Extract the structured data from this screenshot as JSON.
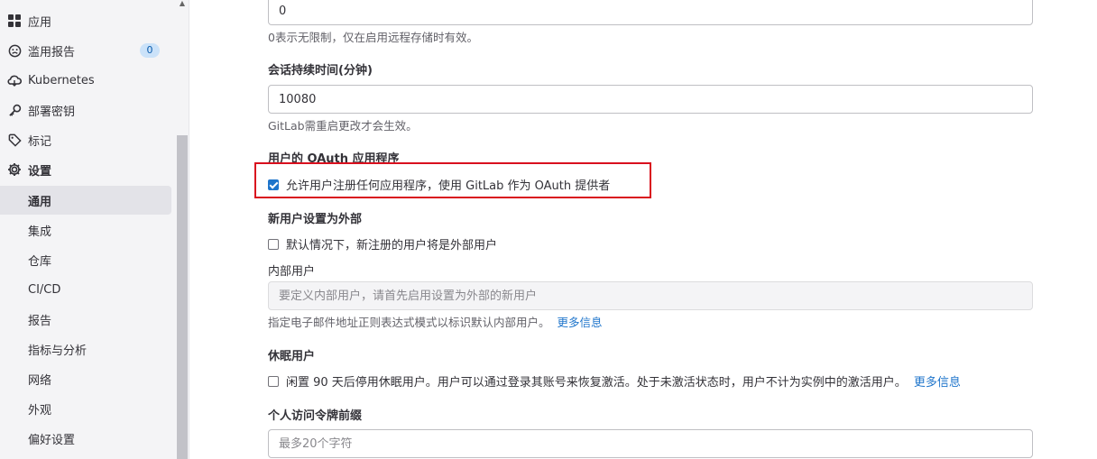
{
  "sidebar": {
    "items": [
      {
        "label": "应用",
        "icon": "grid-icon"
      },
      {
        "label": "滥用报告",
        "icon": "abuse-report-icon",
        "badge": "0"
      },
      {
        "label": "Kubernetes",
        "icon": "cloud-gear-icon"
      },
      {
        "label": "部署密钥",
        "icon": "key-icon"
      },
      {
        "label": "标记",
        "icon": "label-icon"
      },
      {
        "label": "设置",
        "icon": "settings-icon"
      }
    ],
    "sub_items": [
      {
        "label": "通用"
      },
      {
        "label": "集成"
      },
      {
        "label": "仓库"
      },
      {
        "label": "CI/CD"
      },
      {
        "label": "报告"
      },
      {
        "label": "指标与分析"
      },
      {
        "label": "网络"
      },
      {
        "label": "外观"
      },
      {
        "label": "偏好设置"
      }
    ]
  },
  "form": {
    "storage_limit": {
      "value": "0",
      "help": "0表示无限制，仅在启用远程存储时有效。"
    },
    "session_duration": {
      "label": "会话持续时间(分钟)",
      "value": "10080",
      "help": "GitLab需重启更改才会生效。"
    },
    "oauth": {
      "label": "用户的 OAuth 应用程序",
      "checkbox_label": "允许用户注册任何应用程序，使用 GitLab 作为 OAuth 提供者",
      "checked": true
    },
    "external": {
      "label": "新用户设置为外部",
      "checkbox_label": "默认情况下，新注册的用户将是外部用户",
      "checked": false
    },
    "internal_users": {
      "label": "内部用户",
      "placeholder": "要定义内部用户，请首先启用设置为外部的新用户",
      "help": "指定电子邮件地址正则表达式模式以标识默认内部用户。",
      "link": "更多信息"
    },
    "dormant": {
      "label": "休眠用户",
      "checkbox_label": "闲置 90 天后停用休眠用户。用户可以通过登录其账号来恢复激活。处于未激活状态时，用户不计为实例中的激活用户。",
      "link": "更多信息",
      "checked": false
    },
    "token_prefix": {
      "label": "个人访问令牌前缀",
      "placeholder": "最多20个字符"
    }
  },
  "colors": {
    "accent": "#1f75cb",
    "highlight_box": "#d9101e"
  }
}
